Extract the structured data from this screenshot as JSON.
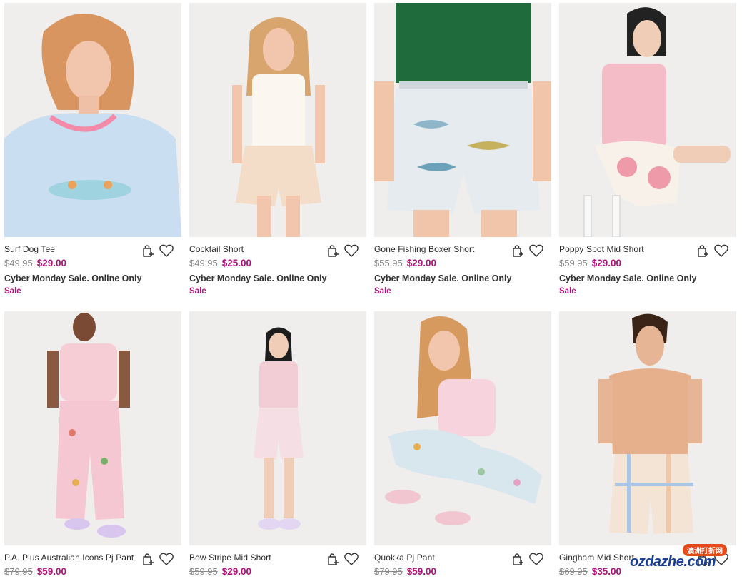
{
  "products": [
    {
      "name": "Surf Dog Tee",
      "was": "$49.95",
      "now": "$29.00",
      "promo": "Cyber Monday Sale. Online Only",
      "badge": "Sale"
    },
    {
      "name": "Cocktail Short",
      "was": "$49.95",
      "now": "$25.00",
      "promo": "Cyber Monday Sale. Online Only",
      "badge": "Sale"
    },
    {
      "name": "Gone Fishing Boxer Short",
      "was": "$55.95",
      "now": "$29.00",
      "promo": "Cyber Monday Sale. Online Only",
      "badge": "Sale"
    },
    {
      "name": "Poppy Spot Mid Short",
      "was": "$59.95",
      "now": "$29.00",
      "promo": "Cyber Monday Sale. Online Only",
      "badge": "Sale"
    },
    {
      "name": "P.A. Plus Australian Icons Pj Pant",
      "was": "$79.95",
      "now": "$59.00"
    },
    {
      "name": "Bow Stripe Mid Short",
      "was": "$59.95",
      "now": "$29.00"
    },
    {
      "name": "Quokka Pj Pant",
      "was": "$79.95",
      "now": "$59.00"
    },
    {
      "name": "Gingham Mid Short",
      "was": "$69.95",
      "now": "$35.00"
    }
  ],
  "icons": {
    "bag": "add-to-bag-icon",
    "wishlist": "heart-icon"
  },
  "colors": {
    "sale_price": "#b1127b",
    "was_price": "#8a8a8a",
    "badge": "#b1127b"
  },
  "watermark": {
    "top": "澳洲打折网",
    "main": "ozdazhe.com"
  }
}
